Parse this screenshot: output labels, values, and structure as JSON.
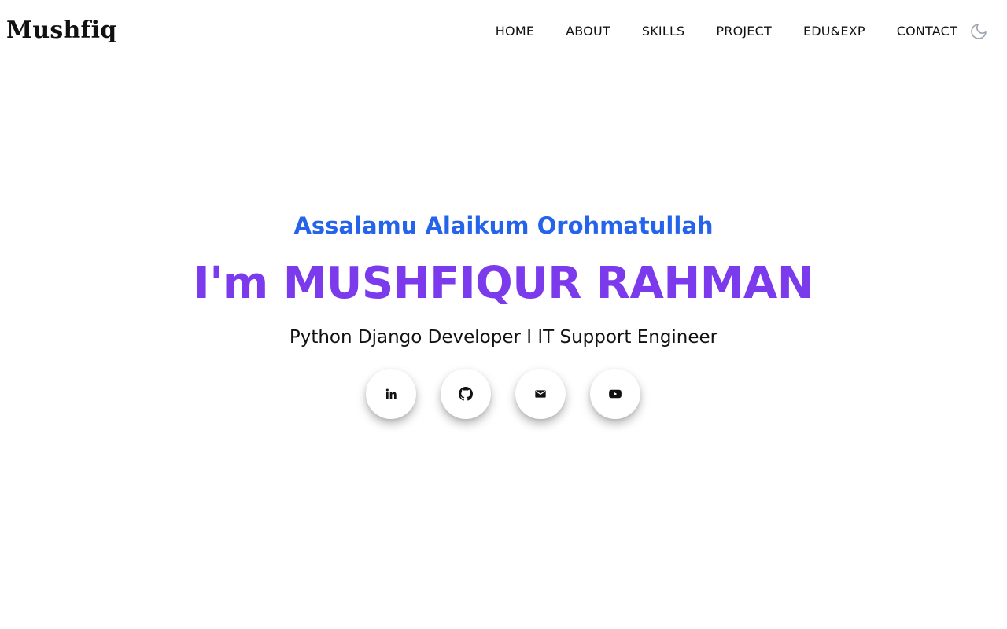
{
  "brand": {
    "name": "Mushfiq"
  },
  "nav": {
    "items": [
      {
        "label": "HOME"
      },
      {
        "label": "ABOUT"
      },
      {
        "label": "SKILLS"
      },
      {
        "label": "PROJECT"
      },
      {
        "label": "EDU&EXP"
      },
      {
        "label": "CONTACT"
      }
    ],
    "theme_toggle_icon": "moon-icon"
  },
  "hero": {
    "greeting": "Assalamu Alaikum Orohmatullah",
    "title": "I'm MUSHFIQUR RAHMAN",
    "subtitle": "Python Django Developer I IT Support Engineer",
    "socials": [
      {
        "icon": "linkedin-icon"
      },
      {
        "icon": "github-icon"
      },
      {
        "icon": "mail-icon"
      },
      {
        "icon": "youtube-icon"
      }
    ]
  },
  "colors": {
    "background": "#ffffff",
    "greeting": "#2563eb",
    "title": "#7c3aed",
    "text": "#111111",
    "moon_icon": "#9ca3af"
  }
}
